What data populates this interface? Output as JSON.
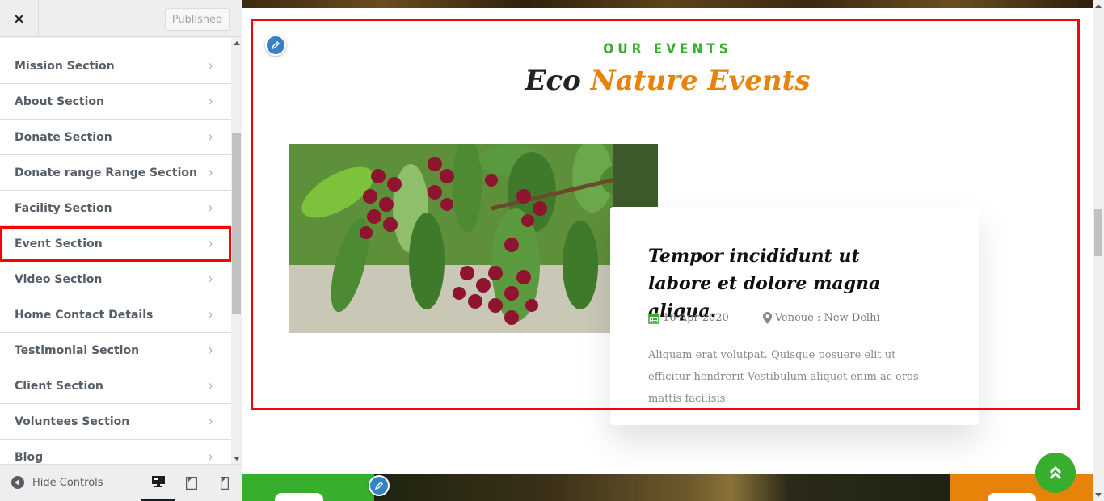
{
  "customizer": {
    "close_label": "×",
    "publish_label": "Published",
    "sections": [
      {
        "label": "Mission Section"
      },
      {
        "label": "About Section"
      },
      {
        "label": "Donate Section"
      },
      {
        "label": "Donate range Range Section"
      },
      {
        "label": "Facility Section"
      },
      {
        "label": "Event Section",
        "highlighted": true
      },
      {
        "label": "Video Section"
      },
      {
        "label": "Home Contact Details"
      },
      {
        "label": "Testimonial Section"
      },
      {
        "label": "Client Section"
      },
      {
        "label": "Voluntees Section"
      },
      {
        "label": "Blog"
      }
    ],
    "chevron": "›",
    "hide_controls_label": "Hide Controls",
    "devices": [
      "desktop",
      "tablet",
      "mobile"
    ],
    "active_device": "desktop"
  },
  "preview": {
    "eyebrow": "OUR EVENTS",
    "heading_dark": "Eco",
    "heading_accent": "Nature Events",
    "event": {
      "image_alt": "Cherries on a tree branch",
      "title": "Tempor incididunt ut labore et dolore magna aliqua.",
      "date": "16 Apr 2020",
      "venue": "Veneue : New Delhi",
      "description": "Aliquam erat volutpat. Quisque posuere elit ut efficitur hendrerit Vestibulum aliquet enim ac eros mattis facilisis."
    },
    "scroll_top_icon": "double-chevron-up"
  },
  "colors": {
    "accent_green": "#38ae2e",
    "accent_orange": "#e8830a",
    "highlight_red": "#ff0000",
    "edit_blue": "#3582c4"
  }
}
